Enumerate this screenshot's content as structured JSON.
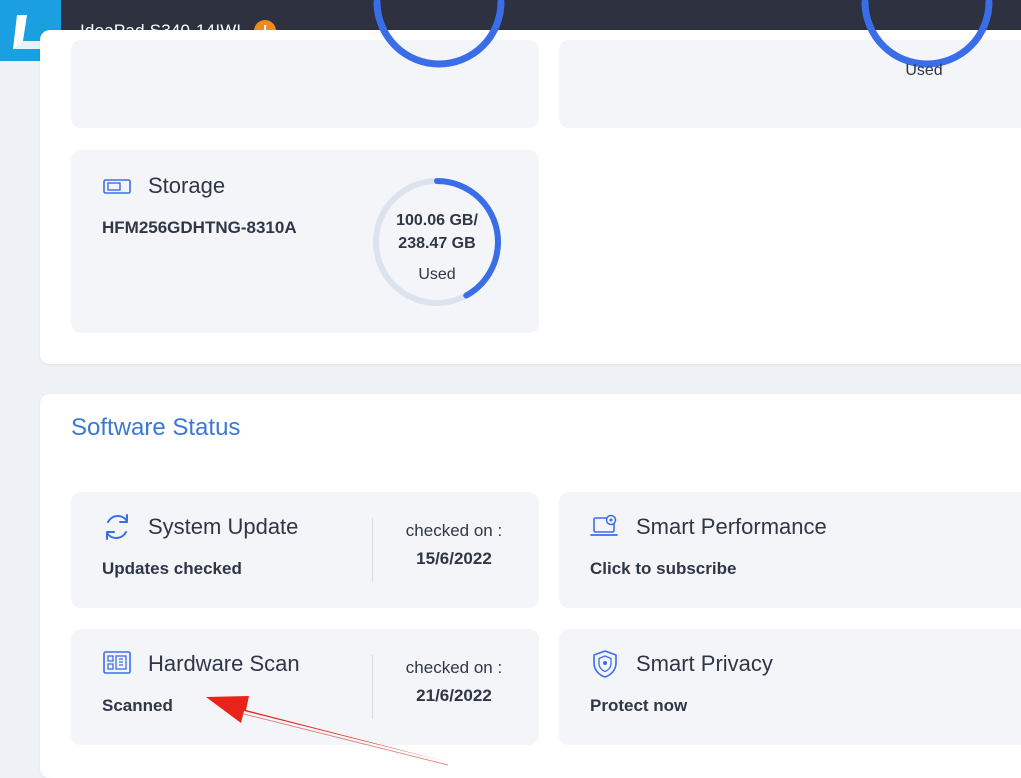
{
  "header": {
    "device_name": "IdeaPad S340-14IWL",
    "logo_letter": "L",
    "warning_symbol": "!"
  },
  "partial_cards": {
    "right_ring_label": "Used"
  },
  "storage": {
    "title": "Storage",
    "model": "HFM256GDHTNG-8310A",
    "used_value": "100.06 GB/",
    "total_value": "238.47 GB",
    "used_label": "Used",
    "used_fraction": 0.42
  },
  "software_status": {
    "section_title": "Software Status",
    "system_update": {
      "title": "System Update",
      "status": "Updates checked",
      "checked_label": "checked on :",
      "checked_date": "15/6/2022"
    },
    "smart_performance": {
      "title": "Smart Performance",
      "action": "Click to subscribe"
    },
    "hardware_scan": {
      "title": "Hardware Scan",
      "status": "Scanned",
      "checked_label": "checked on :",
      "checked_date": "21/6/2022"
    },
    "smart_privacy": {
      "title": "Smart Privacy",
      "action": "Protect now"
    }
  },
  "colors": {
    "accent": "#3a6ee8",
    "ring_track": "#dde3ee",
    "header_bg": "#2d3140",
    "logo_bg": "#1aa0e0",
    "warning": "#f18a1c",
    "annotation_arrow": "#e8231a"
  },
  "icons": {
    "storage": "storage-drive-icon",
    "system_update": "refresh-icon",
    "smart_performance": "laptop-gear-icon",
    "hardware_scan": "circuit-board-icon",
    "smart_privacy": "shield-icon",
    "header_warning": "warning-icon"
  }
}
